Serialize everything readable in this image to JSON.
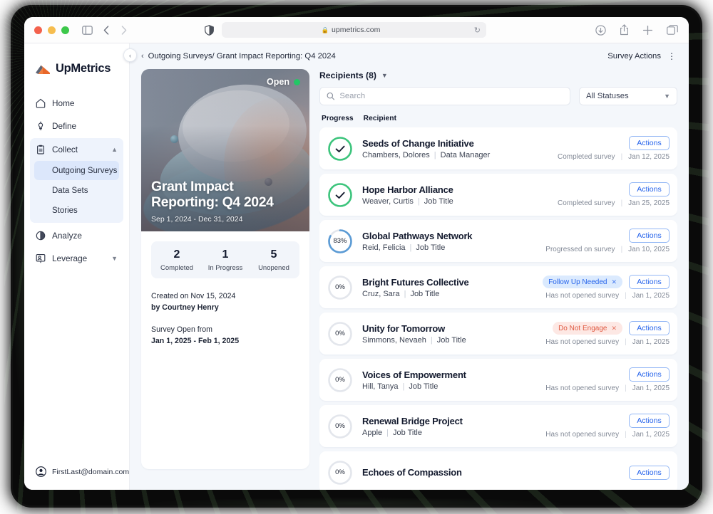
{
  "browser": {
    "url": "upmetrics.com",
    "lock_icon": "lock-icon",
    "reload_icon": "reload-icon",
    "traffic_lights": [
      "close",
      "minimize",
      "zoom"
    ],
    "toolbar_icons": [
      "sidebar-toggle-icon",
      "back-arrow-icon",
      "forward-arrow-icon",
      "reader-shield-icon",
      "downloads-icon",
      "share-icon",
      "new-tab-icon",
      "tab-overview-icon"
    ]
  },
  "sidebar": {
    "brand": "UpMetrics",
    "items": [
      {
        "label": "Home",
        "icon": "home-icon",
        "expandable": false
      },
      {
        "label": "Define",
        "icon": "lightbulb-icon",
        "expandable": false
      },
      {
        "label": "Collect",
        "icon": "clipboard-icon",
        "expandable": true,
        "expanded": true
      },
      {
        "label": "Analyze",
        "icon": "pie-chart-icon",
        "expandable": false
      },
      {
        "label": "Leverage",
        "icon": "presentation-icon",
        "expandable": true,
        "expanded": false
      }
    ],
    "collect_children": [
      {
        "label": "Outgoing Surveys",
        "active": true
      },
      {
        "label": "Data Sets",
        "active": false
      },
      {
        "label": "Stories",
        "active": false
      }
    ],
    "user_email": "FirstLast@domain.com",
    "user_icon": "user-avatar-icon"
  },
  "topbar": {
    "breadcrumb": "Outgoing Surveys/ Grant Impact Reporting: Q4 2024",
    "back_icon": "chevron-left-icon",
    "survey_actions_label": "Survey Actions",
    "kebab_icon": "kebab-menu-icon",
    "collapse_icon": "collapse-panel-icon"
  },
  "survey_card": {
    "status_label": "Open",
    "status_color": "#23c765",
    "title": "Grant Impact Reporting: Q4 2024",
    "date_range": "Sep 1, 2024 - Dec 31, 2024",
    "stats": [
      {
        "value": "2",
        "label": "Completed"
      },
      {
        "value": "1",
        "label": "In Progress"
      },
      {
        "value": "5",
        "label": "Unopened"
      }
    ],
    "created_on": "Created on Nov 15, 2024",
    "created_by": "by Courtney Henry",
    "open_from_label": "Survey Open from",
    "open_from_value": "Jan 1, 2025 - Feb 1, 2025"
  },
  "recipients": {
    "heading": "Recipients (8)",
    "heading_chevron": "chevron-down-icon",
    "search_placeholder": "Search",
    "search_value": "",
    "search_icon": "search-icon",
    "status_filter_value": "All Statuses",
    "status_filter_chevron": "chevron-down-icon",
    "columns": [
      "Progress",
      "Recipient"
    ],
    "actions_label": "Actions",
    "rows": [
      {
        "progress": 100,
        "progress_display": "check",
        "org": "Seeds of Change Initiative",
        "person": "Chambers, Dolores",
        "job_title": "Data Manager",
        "badge": null,
        "status": "Completed survey",
        "date": "Jan 12, 2025"
      },
      {
        "progress": 100,
        "progress_display": "check",
        "org": "Hope Harbor Alliance",
        "person": "Weaver, Curtis",
        "job_title": "Job Title",
        "badge": null,
        "status": "Completed survey",
        "date": "Jan 25, 2025"
      },
      {
        "progress": 83,
        "progress_display": "83%",
        "org": "Global Pathways Network",
        "person": "Reid, Felicia",
        "job_title": "Job Title",
        "badge": null,
        "status": "Progressed on survey",
        "date": "Jan 10, 2025"
      },
      {
        "progress": 0,
        "progress_display": "0%",
        "org": "Bright Futures Collective",
        "person": "Cruz, Sara",
        "job_title": "Job Title",
        "badge": {
          "label": "Follow Up Needed",
          "tone": "blue",
          "dismiss_icon": "close-icon"
        },
        "status": "Has not opened survey",
        "date": "Jan 1, 2025"
      },
      {
        "progress": 0,
        "progress_display": "0%",
        "org": "Unity for Tomorrow",
        "person": "Simmons, Nevaeh",
        "job_title": "Job Title",
        "badge": {
          "label": "Do Not Engage",
          "tone": "red",
          "dismiss_icon": "close-icon"
        },
        "status": "Has not opened survey",
        "date": "Jan 1, 2025"
      },
      {
        "progress": 0,
        "progress_display": "0%",
        "org": "Voices of Empowerment",
        "person": "Hill, Tanya",
        "job_title": "Job Title",
        "badge": null,
        "status": "Has not opened survey",
        "date": "Jan 1, 2025"
      },
      {
        "progress": 0,
        "progress_display": "0%",
        "org": "Renewal Bridge Project",
        "person": "Apple",
        "job_title": "Job Title",
        "badge": null,
        "status": "Has not opened survey",
        "date": "Jan 1, 2025"
      },
      {
        "progress": 0,
        "progress_display": "0%",
        "org": "Echoes of Compassion",
        "person": "",
        "job_title": "",
        "badge": null,
        "status": "",
        "date": ""
      }
    ]
  },
  "colors": {
    "accent_blue": "#2563eb",
    "progress_blue": "#5b9bd5",
    "complete_green": "#3cc47c",
    "status_green": "#23c765",
    "badge_blue_bg": "#dbeafe",
    "badge_red_bg": "#fde8e4",
    "badge_red_fg": "#e05a42",
    "app_bg": "#f4f7fb",
    "brand_orange": "#e8672a"
  }
}
